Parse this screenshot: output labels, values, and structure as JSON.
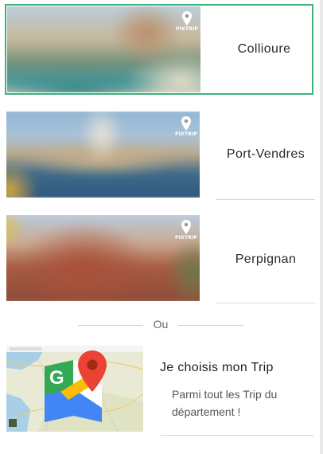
{
  "destinations": [
    {
      "name": "Collioure",
      "badge": "PIXTRIP"
    },
    {
      "name": "Port-Vendres",
      "badge": "PIXTRIP"
    },
    {
      "name": "Perpignan",
      "badge": "PIXTRIP"
    }
  ],
  "separator": {
    "label": "Ou"
  },
  "custom_trip": {
    "title": "Je choisis mon Trip",
    "description": "Parmi tout les Trip du département !"
  },
  "colors": {
    "selected_border": "#3cb27a",
    "divider": "#d8d8d8"
  }
}
